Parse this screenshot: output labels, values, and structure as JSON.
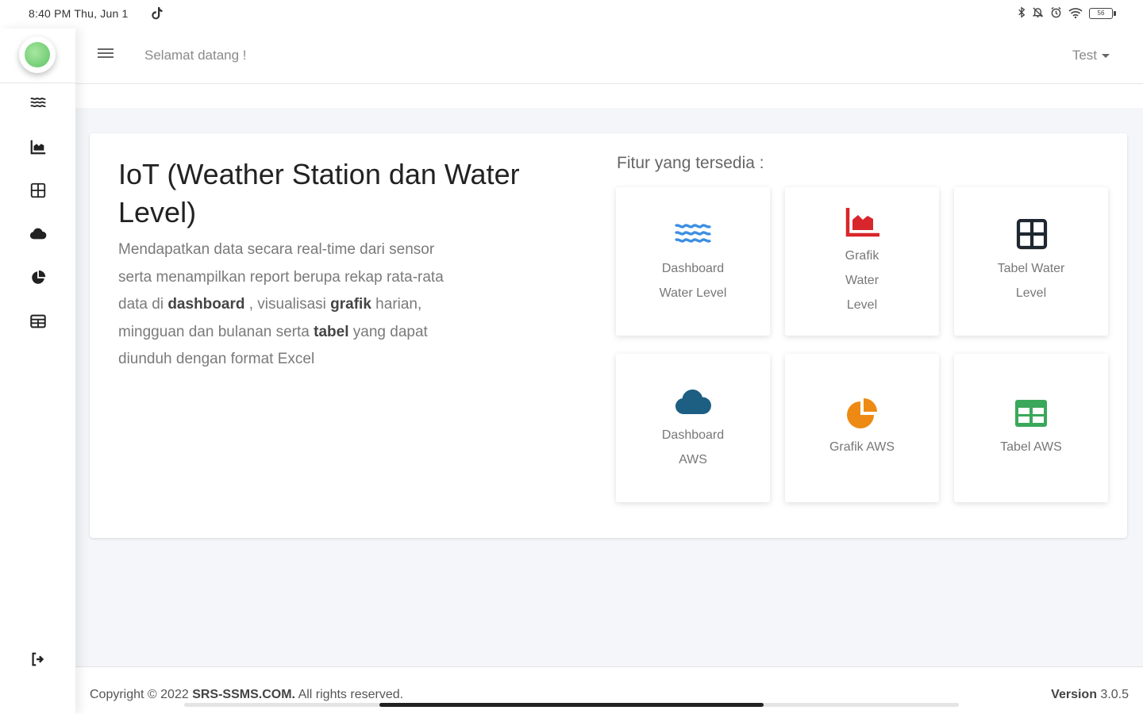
{
  "status_bar": {
    "time": "8:40 PM Thu, Jun 1",
    "battery": "56"
  },
  "sidebar": {
    "items": [
      {
        "name": "dashboard-water-level",
        "icon": "water-icon"
      },
      {
        "name": "grafik-water-level",
        "icon": "area-chart-icon"
      },
      {
        "name": "tabel-water-level",
        "icon": "table-grid-icon"
      },
      {
        "name": "dashboard-aws",
        "icon": "cloud-icon"
      },
      {
        "name": "grafik-aws",
        "icon": "pie-chart-icon"
      },
      {
        "name": "tabel-aws",
        "icon": "table-icon"
      }
    ],
    "logout_icon": "logout-icon"
  },
  "topbar": {
    "welcome": "Selamat datang !",
    "user": "Test"
  },
  "hero": {
    "title": "IoT (Weather Station dan Water Level)",
    "desc_1": "Mendapatkan data secara real-time dari sensor serta menampilkan report berupa rekap rata-rata data di ",
    "desc_b1": "dashboard",
    "desc_2": " , visualisasi ",
    "desc_b2": "grafik",
    "desc_3": " harian, mingguan dan bulanan serta ",
    "desc_b3": "tabel",
    "desc_4": " yang dapat diunduh dengan format Excel"
  },
  "features": {
    "title": "Fitur yang tersedia :",
    "items": [
      {
        "label": "Dashboard Water Level",
        "icon": "water-icon",
        "color": "#3d8fe0"
      },
      {
        "label": "Grafik Water Level",
        "icon": "area-chart-icon",
        "color": "#d8262c"
      },
      {
        "label": "Tabel Water Level",
        "icon": "table-grid-icon",
        "color": "#1f2730"
      },
      {
        "label": "Dashboard AWS",
        "icon": "cloud-icon",
        "color": "#1d5e83"
      },
      {
        "label": "Grafik AWS",
        "icon": "pie-chart-icon",
        "color": "#ee8a14"
      },
      {
        "label": "Tabel AWS",
        "icon": "table-icon",
        "color": "#3aa85b"
      }
    ]
  },
  "footer": {
    "copy_prefix": "Copyright © 2022 ",
    "copy_site": "SRS-SSMS.COM.",
    "copy_suffix": " All rights reserved.",
    "version_label": "Version",
    "version_number": " 3.0.5"
  }
}
